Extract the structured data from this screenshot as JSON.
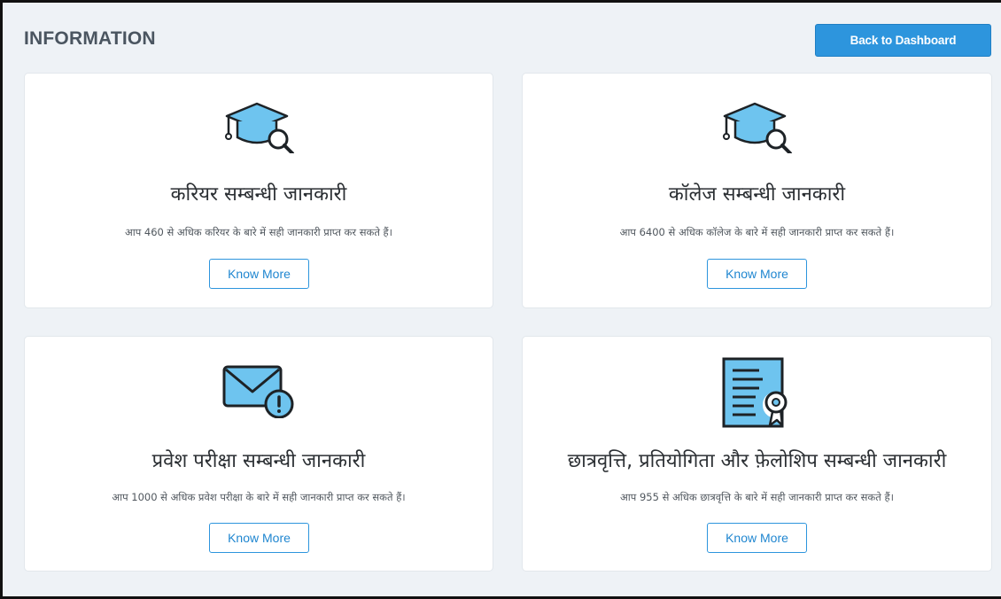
{
  "header": {
    "title": "INFORMATION",
    "back_label": "Back to Dashboard"
  },
  "colors": {
    "accent": "#2d95dd",
    "icon_fill": "#6ec4ef",
    "background": "#eef2f6"
  },
  "cards": [
    {
      "icon": "graduation-cap-search-icon",
      "title": "करियर सम्बन्धी जानकारी",
      "description": "आप 460 से अधिक करियर के बारे में सही जानकारी प्राप्त कर सकते हैं।",
      "button": "Know More"
    },
    {
      "icon": "graduation-cap-search-icon",
      "title": "कॉलेज सम्बन्धी जानकारी",
      "description": "आप 6400 से अधिक कॉलेज के बारे में सही जानकारी प्राप्त कर सकते हैं।",
      "button": "Know More"
    },
    {
      "icon": "envelope-alert-icon",
      "title": "प्रवेश परीक्षा सम्बन्धी जानकारी",
      "description": "आप 1000 से अधिक प्रवेश परीक्षा के बारे में सही जानकारी प्राप्त कर सकते हैं।",
      "button": "Know More"
    },
    {
      "icon": "certificate-icon",
      "title": "छात्रवृत्ति, प्रतियोगिता और फ़ेलोशिप सम्बन्धी जानकारी",
      "description": "आप 955 से अधिक छात्रवृत्ति के बारे में सही जानकारी प्राप्त कर सकते हैं।",
      "button": "Know More"
    }
  ]
}
